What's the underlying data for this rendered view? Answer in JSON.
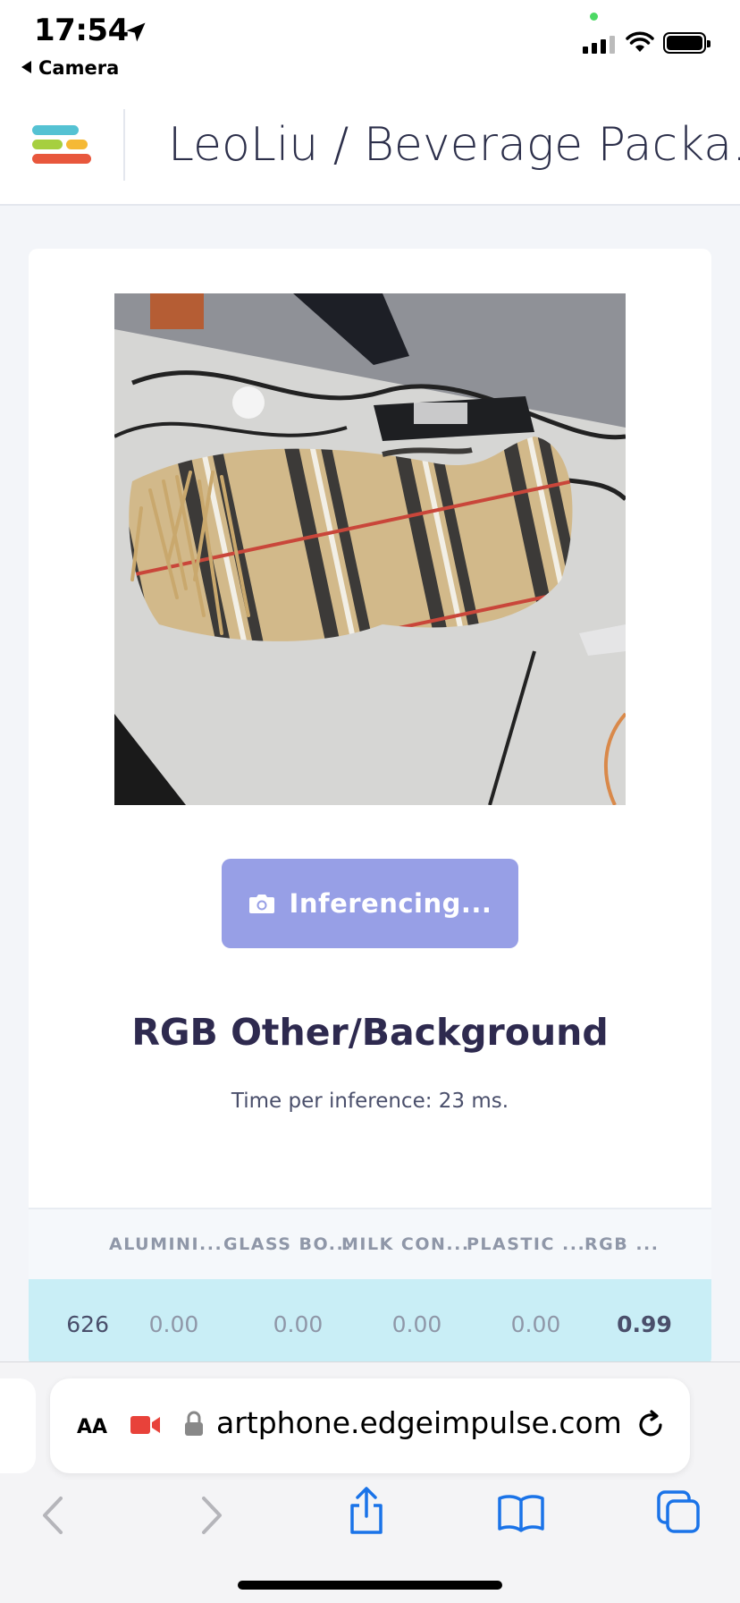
{
  "status_bar": {
    "time": "17:54",
    "back_app": "Camera"
  },
  "header": {
    "project_title": "LeoLiu / Beverage Packa..."
  },
  "photo": {
    "description_icon": "camera-photo"
  },
  "inference": {
    "button_label": "Inferencing...",
    "result_label": "RGB Other/Background",
    "time_per_inference": "Time per inference: 23 ms."
  },
  "table": {
    "headers": [
      "ALUMINI...",
      "GLASS BO...",
      "MILK CON...",
      "PLASTIC ...",
      "RGB ..."
    ],
    "row": {
      "id": "626",
      "values": [
        "0.00",
        "0.00",
        "0.00",
        "0.00",
        "0.99"
      ]
    }
  },
  "browser": {
    "aa_label": "AA",
    "url": "artphone.edgeimpulse.com"
  },
  "colors": {
    "accent_button": "#979fe6",
    "row_highlight": "#c9eef6",
    "logo_teal": "#55c2d3",
    "logo_green": "#a6cf3f",
    "logo_yellow": "#f5b935",
    "logo_red": "#e8573c",
    "ios_blue": "#1a73e8"
  }
}
